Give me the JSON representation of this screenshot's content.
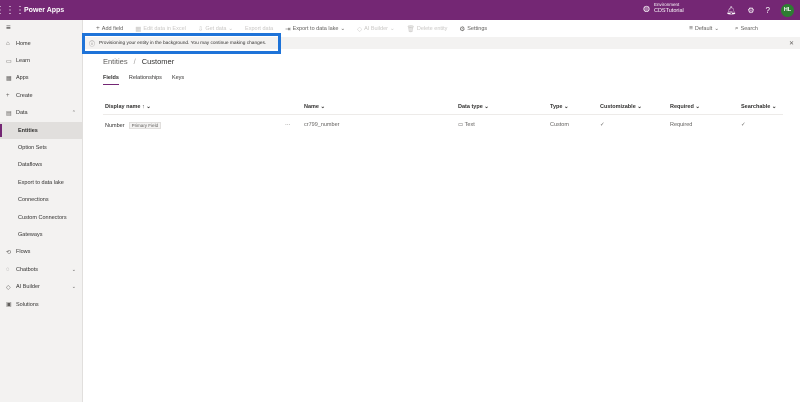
{
  "app": {
    "brand": "Power Apps",
    "user_initials": "HL"
  },
  "environment": {
    "label": "Environment",
    "name": "CDSTutorial"
  },
  "sidebar": {
    "items": [
      {
        "label": "Home",
        "icon": "home-icon",
        "glyph": "⌂"
      },
      {
        "label": "Learn",
        "icon": "book-icon",
        "glyph": "▭"
      },
      {
        "label": "Apps",
        "icon": "apps-icon",
        "glyph": "▦"
      },
      {
        "label": "Create",
        "icon": "plus-icon",
        "glyph": "+"
      },
      {
        "label": "Data",
        "icon": "data-icon",
        "glyph": "▤"
      }
    ],
    "data_sub": [
      "Entities",
      "Option Sets",
      "Dataflows",
      "Export to data lake",
      "Connections",
      "Custom Connectors",
      "Gateways"
    ],
    "bottom": [
      {
        "label": "Flows",
        "icon": "flow-icon",
        "glyph": "⟲"
      },
      {
        "label": "Chatbots",
        "icon": "chatbot-icon",
        "glyph": "◌"
      },
      {
        "label": "AI Builder",
        "icon": "ai-builder-icon",
        "glyph": "◇"
      },
      {
        "label": "Solutions",
        "icon": "solutions-icon",
        "glyph": "▣"
      }
    ]
  },
  "commandbar": {
    "add_field": "Add field",
    "edit_data": "Edit data in Excel",
    "get_data": "Get data",
    "export_data": "Export data",
    "export_lake": "Export to data lake",
    "ai_builder": "AI Builder",
    "delete_entity": "Delete entity",
    "settings": "Settings",
    "view": "Default",
    "search": "Search"
  },
  "infobar": {
    "message": "Provisioning your entity in the background. You may continue making changes."
  },
  "breadcrumb": {
    "parent": "Entities",
    "current": "Customer"
  },
  "tabs": [
    "Fields",
    "Relationships",
    "Keys"
  ],
  "grid": {
    "columns": [
      "Display name",
      "Name",
      "Data type",
      "Type",
      "Customizable",
      "Required",
      "Searchable"
    ],
    "rows": [
      {
        "display_name": "Number",
        "badge": "Primary Field",
        "name": "cr799_number",
        "data_type": "Text",
        "type": "Custom",
        "required": "Required"
      }
    ]
  }
}
